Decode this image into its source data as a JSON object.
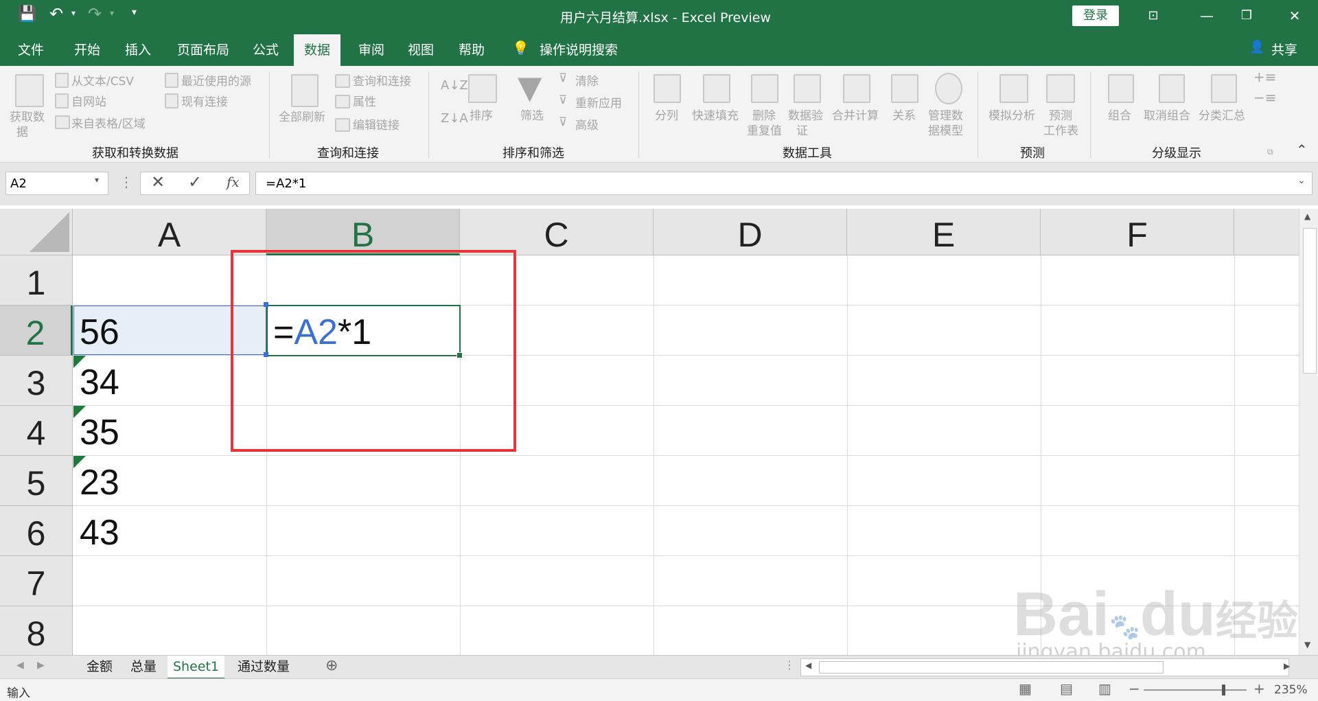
{
  "window": {
    "title": "用户六月结算.xlsx  -  Excel Preview",
    "login": "登录"
  },
  "tabs": [
    "文件",
    "开始",
    "插入",
    "页面布局",
    "公式",
    "数据",
    "审阅",
    "视图",
    "帮助"
  ],
  "active_tab": "数据",
  "tell_me": "操作说明搜索",
  "share": "共享",
  "ribbon": {
    "get_data": "获取数",
    "get_data2": "据",
    "from_text": "从文本/CSV",
    "from_web": "自网站",
    "from_table": "来自表格/区域",
    "recent_sources": "最近使用的源",
    "existing_conn": "现有连接",
    "refresh_all": "全部刷新",
    "queries_conn": "查询和连接",
    "properties": "属性",
    "edit_links": "编辑链接",
    "sort": "排序",
    "filter": "筛选",
    "clear": "清除",
    "reapply": "重新应用",
    "advanced": "高级",
    "text_to_col": "分列",
    "flash_fill": "快速填充",
    "remove_dup": "删除",
    "remove_dup2": "重复值",
    "data_valid": "数据验",
    "data_valid2": "证",
    "consolidate": "合并计算",
    "relations": "关系",
    "manage_model": "管理数",
    "manage_model2": "据模型",
    "whatif": "模拟分析",
    "forecast": "预测",
    "forecast_sheet": "工作表",
    "group": "组合",
    "ungroup": "取消组合",
    "subtotal": "分类汇总",
    "groups": {
      "get_transform": "获取和转换数据",
      "queries": "查询和连接",
      "sort_filter": "排序和筛选",
      "data_tools": "数据工具",
      "forecast": "预测",
      "outline": "分级显示"
    }
  },
  "formula_bar": {
    "name_box": "A2",
    "formula": "=A2*1",
    "fx": "fx"
  },
  "columns": [
    "A",
    "B",
    "C",
    "D",
    "E",
    "F"
  ],
  "rows": [
    "1",
    "2",
    "3",
    "4",
    "5",
    "6",
    "7",
    "8"
  ],
  "cells": {
    "a2": "56",
    "a3": "34",
    "a4": "35",
    "a5": "23",
    "a6": "43",
    "b2_eq": "=",
    "b2_ref": "A2",
    "b2_rest": "*1"
  },
  "sheets": [
    "金额",
    "总量",
    "Sheet1",
    "通过数量"
  ],
  "active_sheet": "Sheet1",
  "status": {
    "mode": "输入",
    "zoom": "235%"
  },
  "watermark": {
    "brand": "Bai",
    "brand2": "du",
    "cn": "经验",
    "url": "jingyan.baidu.com"
  },
  "colors": {
    "excel_green": "#217346",
    "formula_ref_blue": "#3b6fd0",
    "annotation_red": "#e8333b"
  }
}
